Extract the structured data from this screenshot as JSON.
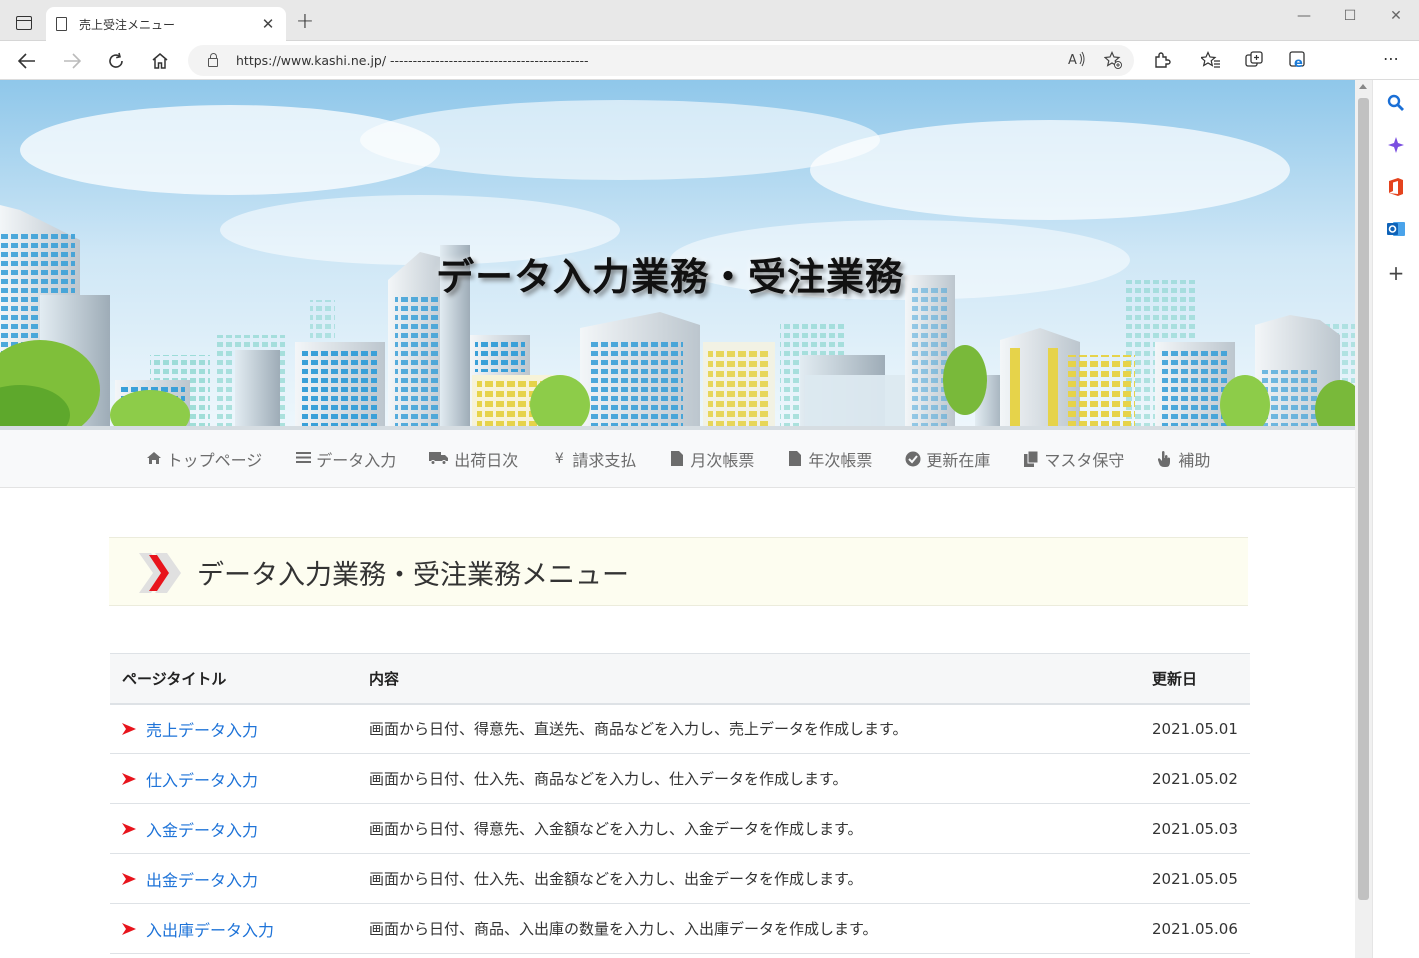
{
  "browser": {
    "tab_title": "売上受注メニュー",
    "tab_close": "✕",
    "new_tab": "+",
    "url": "https://www.kashi.ne.jp/ --------------------------------------------",
    "window_controls": {
      "minimize": "—",
      "maximize": "☐",
      "close": "✕"
    },
    "toolbar": {
      "more": "⋯"
    }
  },
  "hero": {
    "title": "データ入力業務・受注業務"
  },
  "nav": {
    "items": [
      {
        "icon": "home-icon",
        "label": "トップページ"
      },
      {
        "icon": "list-icon",
        "label": "データ入力"
      },
      {
        "icon": "truck-icon",
        "label": "出荷日次"
      },
      {
        "icon": "yen-icon",
        "label": "請求支払"
      },
      {
        "icon": "document-icon",
        "label": "月次帳票"
      },
      {
        "icon": "document-icon",
        "label": "年次帳票"
      },
      {
        "icon": "check-circle-icon",
        "label": "更新在庫"
      },
      {
        "icon": "copy-icon",
        "label": "マスタ保守"
      },
      {
        "icon": "hand-pointer-icon",
        "label": "補助"
      }
    ]
  },
  "section": {
    "title": "データ入力業務・受注業務メニュー"
  },
  "table": {
    "headers": {
      "title": "ページタイトル",
      "content": "内容",
      "date": "更新日"
    },
    "rows": [
      {
        "title": "売上データ入力",
        "content": "画面から日付、得意先、直送先、商品などを入力し、売上データを作成します。",
        "date": "2021.05.01"
      },
      {
        "title": "仕入データ入力",
        "content": "画面から日付、仕入先、商品などを入力し、仕入データを作成します。",
        "date": "2021.05.02"
      },
      {
        "title": "入金データ入力",
        "content": "画面から日付、得意先、入金額などを入力し、入金データを作成します。",
        "date": "2021.05.03"
      },
      {
        "title": "出金データ入力",
        "content": "画面から日付、仕入先、出金額などを入力し、出金データを作成します。",
        "date": "2021.05.05"
      },
      {
        "title": "入出庫データ入力",
        "content": "画面から日付、商品、入出庫の数量を入力し、入出庫データを作成します。",
        "date": "2021.05.06"
      }
    ]
  },
  "colors": {
    "link": "#1e73d8",
    "chevron_red": "#e8141c",
    "section_bg": "#fdfdf0",
    "nav_text": "#6c6c6c"
  }
}
